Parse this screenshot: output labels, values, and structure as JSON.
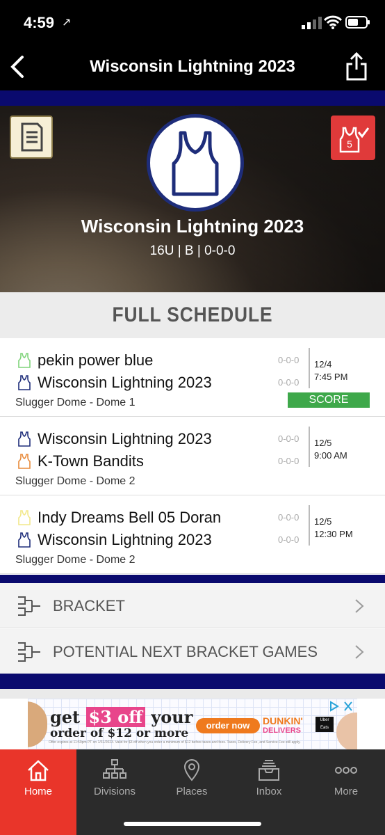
{
  "status": {
    "time": "4:59",
    "location_glyph": "↗"
  },
  "nav": {
    "title": "Wisconsin Lightning 2023"
  },
  "team": {
    "name": "Wisconsin Lightning 2023",
    "subtitle": "16U | B | 0-0-0"
  },
  "score_button": {
    "count": "5"
  },
  "schedule": {
    "header": "FULL SCHEDULE",
    "games": [
      {
        "team1": "pekin power blue",
        "team1_color": "#7fd37a",
        "team1_record": "0-0-0",
        "team2": "Wisconsin Lightning 2023",
        "team2_color": "#1e2d7a",
        "team2_record": "0-0-0",
        "venue": "Slugger Dome - Dome 1",
        "date": "12/4",
        "time": "7:45 PM",
        "action": "SCORE"
      },
      {
        "team1": "Wisconsin Lightning 2023",
        "team1_color": "#1e2d7a",
        "team1_record": "0-0-0",
        "team2": "K-Town Bandits",
        "team2_color": "#e88a3a",
        "team2_record": "0-0-0",
        "venue": "Slugger Dome - Dome 2",
        "date": "12/5",
        "time": "9:00 AM"
      },
      {
        "team1": "Indy Dreams Bell 05 Doran",
        "team1_color": "#f2e88a",
        "team1_record": "0-0-0",
        "team2": "Wisconsin Lightning 2023",
        "team2_color": "#1e2d7a",
        "team2_record": "0-0-0",
        "venue": "Slugger Dome - Dome 2",
        "date": "12/5",
        "time": "12:30 PM"
      }
    ]
  },
  "menu": [
    {
      "label": "BRACKET"
    },
    {
      "label": "POTENTIAL NEXT BRACKET GAMES"
    }
  ],
  "ad": {
    "line1_pre": "get ",
    "line1_price": "$3 off",
    "line1_post": " your",
    "line2": "order of $12 or more",
    "cta": "order now",
    "brand1": "DUNKIN'",
    "brand2": "DELIVERS",
    "ue": "Uber Eats",
    "fine": "Offer expires at 11:59pm PT on 1/31/2023. Valid for $3 off when you order a minimum of $12 before taxes and fees. Taxes, Delivery Fee, and Service Fee still apply."
  },
  "tabs": [
    {
      "label": "Home",
      "icon": "home-icon",
      "active": true
    },
    {
      "label": "Divisions",
      "icon": "divisions-icon"
    },
    {
      "label": "Places",
      "icon": "places-icon"
    },
    {
      "label": "Inbox",
      "icon": "inbox-icon"
    },
    {
      "label": "More",
      "icon": "more-icon"
    }
  ],
  "colors": {
    "accent_red": "#e9352a",
    "navy": "#0a0a6e",
    "score_green": "#3ea84a"
  }
}
